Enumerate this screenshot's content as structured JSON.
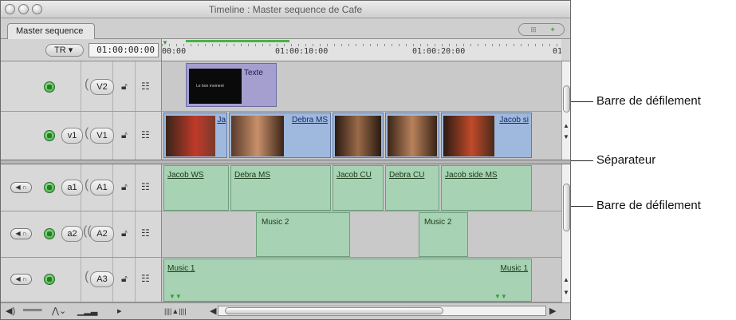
{
  "window": {
    "title": "Timeline : Master sequence de Cafe",
    "tab": "Master sequence",
    "track_select": "TR",
    "timecode": "01:00:00:00"
  },
  "ruler": {
    "ticks": [
      "00:00",
      "01:00:10:00",
      "01:00:20:00",
      "01"
    ]
  },
  "video_tracks": [
    {
      "source": "",
      "dest": "V2",
      "clips": [
        {
          "name": "Texte",
          "thumb_text": "Le bon moment"
        }
      ]
    },
    {
      "source": "v1",
      "dest": "V1",
      "clips": [
        {
          "name": "Ja"
        },
        {
          "name": "Debra MS"
        },
        {
          "name": ""
        },
        {
          "name": ""
        },
        {
          "name": "Jacob si"
        }
      ]
    }
  ],
  "audio_tracks": [
    {
      "source": "a1",
      "dest": "A1",
      "clips": [
        "Jacob WS",
        "Debra MS",
        "Jacob CU",
        "Debra CU",
        "Jacob side MS"
      ]
    },
    {
      "source": "a2",
      "dest": "A2",
      "clips": [
        "Music 2",
        "Music 2"
      ]
    },
    {
      "source": "",
      "dest": "A3",
      "clips": [
        "Music 1",
        "Music 1"
      ]
    }
  ],
  "icons": {
    "lock": "padlock-icon",
    "patch": "patch-panel-icon",
    "visibility": "green-visibility-icon",
    "audio": "speaker-icon"
  },
  "annotations": {
    "scrollbar_top": "Barre de défilement",
    "separator": "Séparateur",
    "scrollbar_bottom": "Barre de défilement"
  },
  "colors": {
    "video_clip": "#9fb8dd",
    "audio_clip": "#a7d2b3",
    "text_clip": "#a59fd0",
    "visibility_green": "#2f9e2f"
  }
}
